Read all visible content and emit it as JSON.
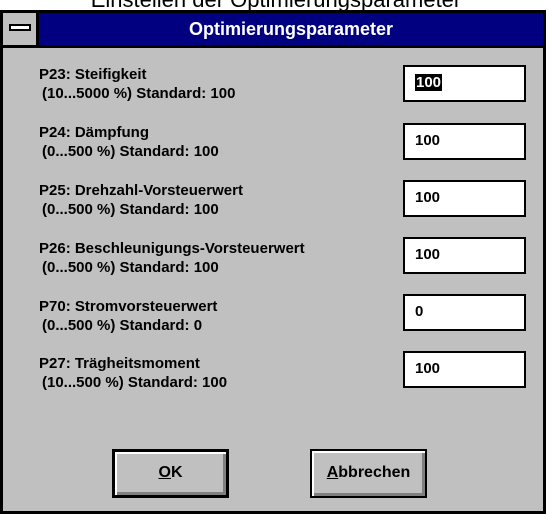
{
  "caption_above": "Einstellen der Optimierungsparameter",
  "window": {
    "title": "Optimierungsparameter"
  },
  "params": [
    {
      "label": "P23: Steifigkeit",
      "range": "(10...5000 %)  Standard: 100",
      "value": "100",
      "selected": true
    },
    {
      "label": "P24: Dämpfung",
      "range": "(0...500 %)  Standard: 100",
      "value": "100"
    },
    {
      "label": "P25: Drehzahl-Vorsteuerwert",
      "range": "(0...500 %)  Standard: 100",
      "value": "100"
    },
    {
      "label": "P26: Beschleunigungs-Vorsteuerwert",
      "range": "(0...500 %)  Standard: 100",
      "value": "100"
    },
    {
      "label": "P70: Stromvorsteuerwert",
      "range": "(0...500 %)  Standard: 0",
      "value": "0"
    },
    {
      "label": "P27: Trägheitsmoment",
      "range": "(10...500 %)  Standard: 100",
      "value": "100"
    }
  ],
  "buttons": {
    "ok": {
      "mnemonic": "O",
      "rest": "K"
    },
    "cancel": {
      "mnemonic": "A",
      "rest": "bbrechen"
    }
  }
}
